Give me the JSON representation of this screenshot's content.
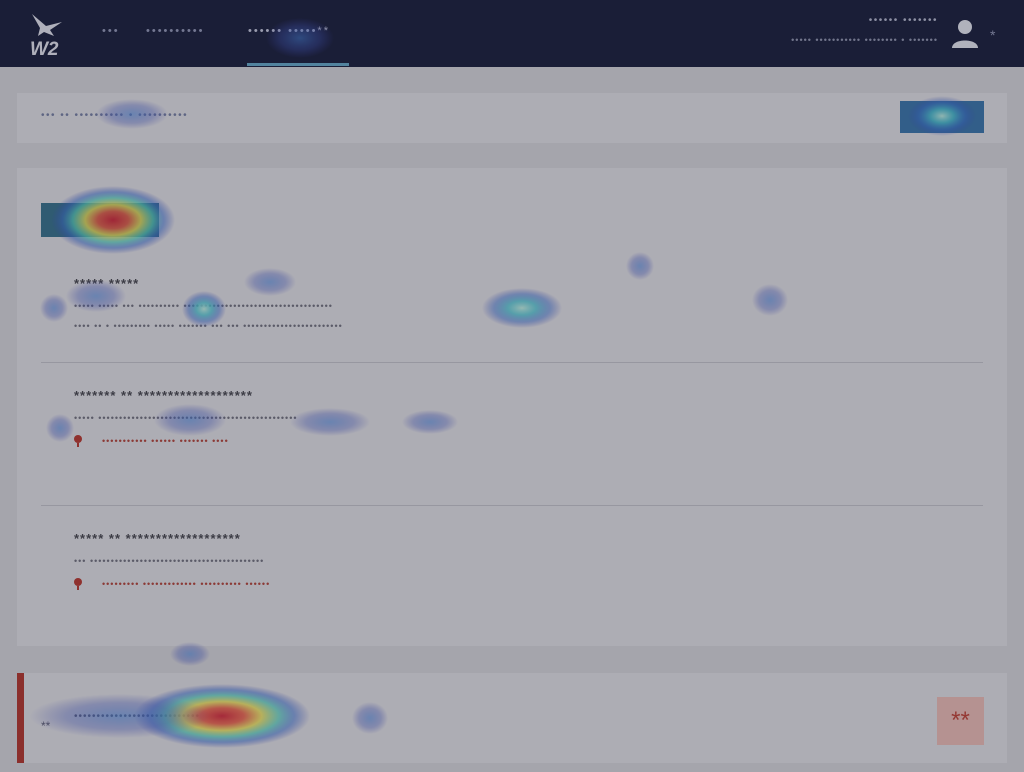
{
  "header": {
    "logo_text": "W2",
    "nav": [
      {
        "label": "•••"
      },
      {
        "label": "••••••••••"
      },
      {
        "label": "•••••• •••••",
        "suffix": "**"
      }
    ],
    "user_name": "•••••• •••••••",
    "user_sub": "••••• ••••••••••• •••••••• • •••••••",
    "caret": "*"
  },
  "breadcrumb": {
    "text": "••• •• •••••••••• • ••••••••••",
    "button_label": ""
  },
  "main": {
    "primary_button": "",
    "sections": [
      {
        "title": "***** *****",
        "lines": [
          "••••• ••••• ••• •••••••••• ••••••••••••••••••••••••••••••••••••",
          "•••• •• • ••••••••• ••••• ••••••• ••• ••• ••••••••••••••••••••••••"
        ]
      },
      {
        "title": "******* ** *******************",
        "lines": [
          "••••• ••••••••••••••••••••••••••••••••••••••••••••••••"
        ],
        "link": "••••••••••• •••••• ••••••• ••••"
      },
      {
        "title": "***** ** *******************",
        "lines": [
          "••• ••••••••••••••••••••••••••••••••••••••••••"
        ],
        "link": "••••••••• ••••••••••••• •••••••••• ••••••"
      }
    ]
  },
  "alert": {
    "icon": "**",
    "text": "••••••••••••••••••••••••••••",
    "close_label": "**"
  },
  "colors": {
    "topbar": "#0b1130",
    "accent_red": "#b22a20",
    "primary": "#2c6b86"
  }
}
